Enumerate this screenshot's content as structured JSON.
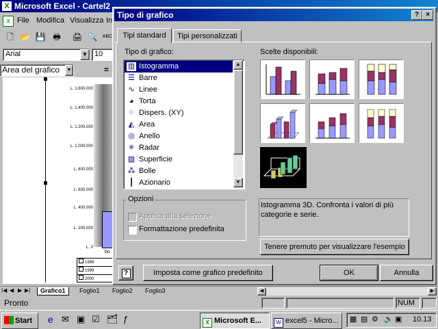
{
  "excel": {
    "title": "Microsoft Excel - Cartel2",
    "menu": [
      "File",
      "Modifica",
      "Visualizza",
      "In"
    ],
    "font_name": "Arial",
    "font_size": "10",
    "name_box": "Area del grafico",
    "chart_y_labels": [
      "L. 1.600.000",
      "L. 1.400.000",
      "L. 1.200.000",
      "L. 1.000.000",
      "L. 800.000",
      "L. 600.000",
      "L. 400.000",
      "L. 200.000",
      "L. 0"
    ],
    "legend_years": [
      "1998",
      "1999",
      "2000"
    ],
    "axis_label": "bo",
    "sheet_tabs": [
      "Grafico1",
      "Foglio1",
      "Foglio2",
      "Foglio3"
    ],
    "active_sheet": "Grafico1",
    "status": "Pronto",
    "num_indicator": "NUM"
  },
  "dialog": {
    "title": "Tipo di grafico",
    "tabs": [
      "Tipi standard",
      "Tipi personalizzati"
    ],
    "list_label": "Tipo di grafico:",
    "chart_types": [
      {
        "label": "Istogramma",
        "icon": "column-chart-icon"
      },
      {
        "label": "Barre",
        "icon": "bar-chart-icon"
      },
      {
        "label": "Linee",
        "icon": "line-chart-icon"
      },
      {
        "label": "Torta",
        "icon": "pie-chart-icon"
      },
      {
        "label": "Dispers. (XY)",
        "icon": "scatter-chart-icon"
      },
      {
        "label": "Area",
        "icon": "area-chart-icon"
      },
      {
        "label": "Anello",
        "icon": "doughnut-chart-icon"
      },
      {
        "label": "Radar",
        "icon": "radar-chart-icon"
      },
      {
        "label": "Superficie",
        "icon": "surface-chart-icon"
      },
      {
        "label": "Bolle",
        "icon": "bubble-chart-icon"
      },
      {
        "label": "Azionario",
        "icon": "stock-chart-icon"
      }
    ],
    "selected_type": "Istogramma",
    "subtypes_label": "Scelte disponibili:",
    "options_label": "Opzioni",
    "apply_to_selection": "Applica alla selezione",
    "default_formatting": "Formattazione predefinita",
    "description": "Istogramma 3D. Confronta i valori di più categorie e serie.",
    "preview_button": "Tenere premuto per visualizzare l'esempio",
    "set_default_button": "Imposta come grafico predefinito",
    "ok_button": "OK",
    "cancel_button": "Annulla",
    "help_button": "?",
    "close_button": "×"
  },
  "taskbar": {
    "start": "Start",
    "tasks": [
      "Microsoft E...",
      "excel5 - Micro..."
    ],
    "clock": "10.13"
  },
  "colors": {
    "title_bar": "#000080",
    "desktop": "#008080",
    "face": "#c0c0c0",
    "series1": "#9999ff",
    "series2": "#993366",
    "series3": "#ffffcc"
  }
}
